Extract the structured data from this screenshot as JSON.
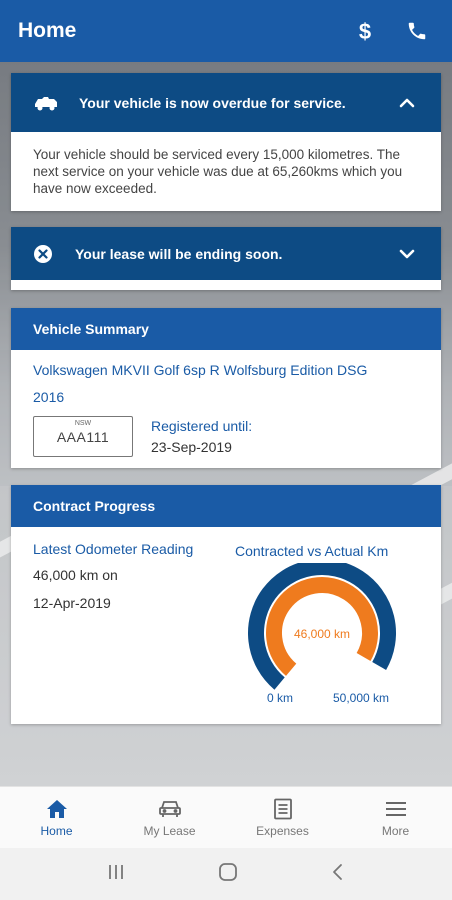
{
  "header": {
    "title": "Home",
    "icons": [
      "dollar-icon",
      "phone-icon"
    ]
  },
  "alerts": [
    {
      "title": "Your vehicle is now overdue for service.",
      "icon": "car-service-icon",
      "expanded": true,
      "body": "Your vehicle should be serviced every 15,000 kilometres. The next service on your vehicle was due at 65,260kms which you have now exceeded."
    },
    {
      "title": "Your lease will be ending soon.",
      "icon": "close-circle-icon",
      "expanded": false
    }
  ],
  "vehicle_summary": {
    "heading": "Vehicle Summary",
    "vehicle_line1": "Volkswagen MKVII Golf 6sp R Wolfsburg Edition DSG",
    "vehicle_line2": "2016",
    "plate_state": "NSW",
    "plate_number": "AAA111",
    "registered_label": "Registered until:",
    "registered_date": "23-Sep-2019"
  },
  "contract_progress": {
    "heading": "Contract Progress",
    "odometer_label": "Latest Odometer Reading",
    "odometer_value": "46,000 km on",
    "odometer_date": "12-Apr-2019",
    "gauge_title": "Contracted vs Actual Km",
    "gauge_value_label": "46,000 km",
    "gauge_min_label": "0 km",
    "gauge_max_label": "50,000 km",
    "actual_km": 46000,
    "contracted_km": 50000,
    "colors": {
      "outer": "#0d4b84",
      "inner": "#ef7b1e"
    }
  },
  "bottom_nav": [
    {
      "label": "Home",
      "icon": "home-icon",
      "active": true
    },
    {
      "label": "My Lease",
      "icon": "car-icon",
      "active": false
    },
    {
      "label": "Expenses",
      "icon": "document-icon",
      "active": false
    },
    {
      "label": "More",
      "icon": "menu-icon",
      "active": false
    }
  ],
  "system_nav": [
    "recent-apps-icon",
    "home-circle-icon",
    "back-icon"
  ]
}
